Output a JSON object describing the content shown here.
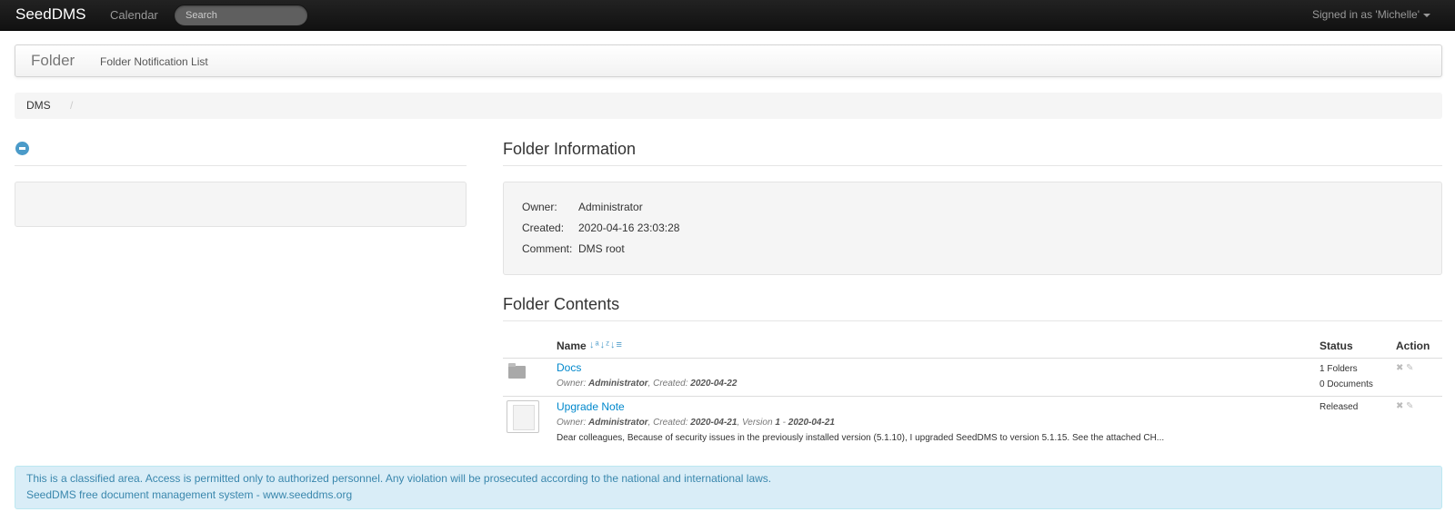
{
  "navbar": {
    "brand": "SeedDMS",
    "calendar": "Calendar",
    "search_placeholder": "Search",
    "signed_in": "Signed in as 'Michelle'"
  },
  "header": {
    "title": "Folder",
    "link": "Folder Notification List"
  },
  "breadcrumb": {
    "items": [
      "DMS"
    ],
    "separator": "/"
  },
  "folder_info": {
    "title": "Folder Information",
    "owner_label": "Owner:",
    "owner_value": "Administrator",
    "created_label": "Created:",
    "created_value": "2020-04-16 23:03:28",
    "comment_label": "Comment:",
    "comment_value": "DMS root"
  },
  "folder_contents": {
    "title": "Folder Contents",
    "columns": {
      "name": "Name",
      "status": "Status",
      "action": "Action"
    },
    "sort_icons": [
      "sort-alpha-asc-icon",
      "sort-alpha-desc-icon",
      "sort-order-icon"
    ],
    "rows": [
      {
        "icon": "folder-icon",
        "name": "Docs",
        "meta": {
          "owner_label": "Owner: ",
          "owner": "Administrator",
          "created_label": ", Created: ",
          "created": "2020-04-22"
        },
        "status_lines": [
          "1 Folders",
          "0 Documents"
        ]
      },
      {
        "icon": "document-icon",
        "name": "Upgrade Note",
        "meta": {
          "owner_label": "Owner: ",
          "owner": "Administrator",
          "created_label": ", Created: ",
          "created": "2020-04-21",
          "version_label": ", Version ",
          "version": "1",
          "version_date": "2020-04-21"
        },
        "comment": "Dear colleagues, Because of security issues in the previously installed version (5.1.10), I upgraded SeedDMS to version 5.1.15. See the attached CH...",
        "status_lines": [
          "Released"
        ]
      }
    ]
  },
  "footer": {
    "notice": "This is a classified area. Access is permitted only to authorized personnel. Any violation will be prosecuted according to the national and international laws.",
    "credit": "SeedDMS free document management system - www.seeddms.org"
  },
  "colors": {
    "navbar": "#1b1b1b",
    "link": "#0088cc",
    "alert_bg": "#d9edf7",
    "alert_text": "#3a87ad"
  }
}
